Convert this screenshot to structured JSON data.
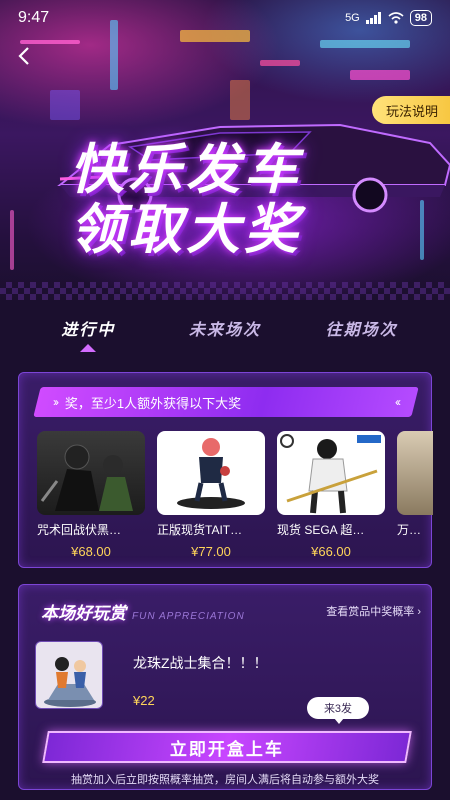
{
  "status_bar": {
    "time": "9:47",
    "signal": "5G",
    "battery": "98"
  },
  "header": {
    "rules_label": "玩法说明",
    "title_line1": "快乐发车",
    "title_line2": "领取大奖"
  },
  "tabs": [
    {
      "label": "进行中",
      "active": true
    },
    {
      "label": "未来场次",
      "active": false
    },
    {
      "label": "往期场次",
      "active": false
    }
  ],
  "prizes_panel": {
    "marquee_text": "奖，至少1人额外获得以下大奖",
    "items": [
      {
        "name": "咒术回战伏黑…",
        "price": "¥68.00"
      },
      {
        "name": "正版现货TAIT…",
        "price": "¥77.00"
      },
      {
        "name": "现货 SEGA 超…",
        "price": "¥66.00"
      },
      {
        "name": "万…",
        "price": ""
      }
    ]
  },
  "fun_panel": {
    "title": "本场好玩赏",
    "subtitle": "FUN APPRECIATION",
    "odds_link": "查看赏品中奖概率 ›",
    "box_name": "龙珠Z战士集合！！！",
    "box_price": "¥22",
    "bubble": "来3发",
    "cta_label": "立即开盒上车",
    "footnote": "抽赏加入后立即按照概率抽赏，房间人满后将自动参与额外大奖"
  },
  "colors": {
    "accent": "#c846ff",
    "price": "#ffd55a",
    "rules_bg": "#f7c742"
  }
}
